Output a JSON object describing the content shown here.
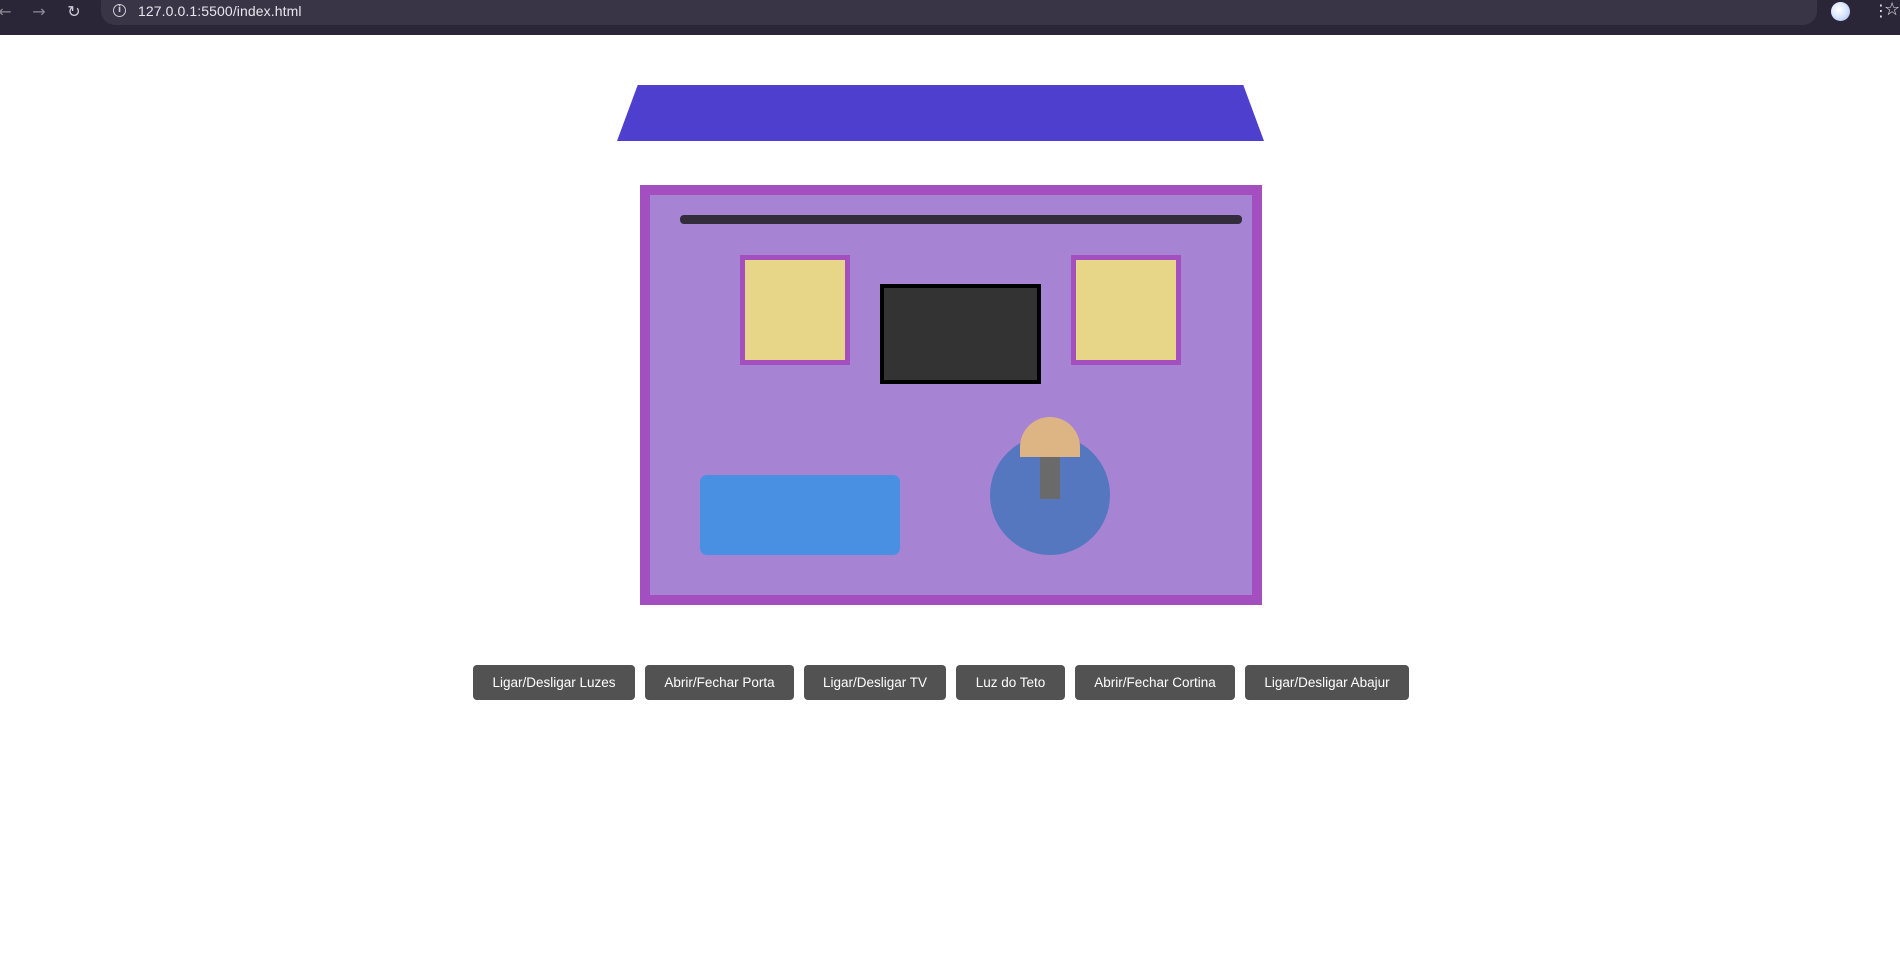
{
  "browser": {
    "url": "127.0.0.1:5500/index.html",
    "icons": {
      "back": "arrow-left-icon",
      "forward": "arrow-right-icon",
      "reload": "reload-icon",
      "info": "info-icon",
      "bookmark": "star-icon",
      "menu": "kebab-menu-icon"
    }
  },
  "scene": {
    "colors": {
      "roof": "#4e3fcf",
      "room_fill": "#a683d3",
      "room_border": "#a34fbf",
      "curtain_rod": "#322c3c",
      "window": "#e7d687",
      "tv": "#333333",
      "door": "#4a90e2",
      "lamp_glow": "#5577c0",
      "lamp_shade": "#ddb484",
      "lamp_stem": "#6a6a6a"
    }
  },
  "controls": {
    "lights": "Ligar/Desligar Luzes",
    "door": "Abrir/Fechar Porta",
    "tv": "Ligar/Desligar TV",
    "ceiling_light": "Luz do Teto",
    "curtain": "Abrir/Fechar Cortina",
    "lamp": "Ligar/Desligar Abajur"
  }
}
